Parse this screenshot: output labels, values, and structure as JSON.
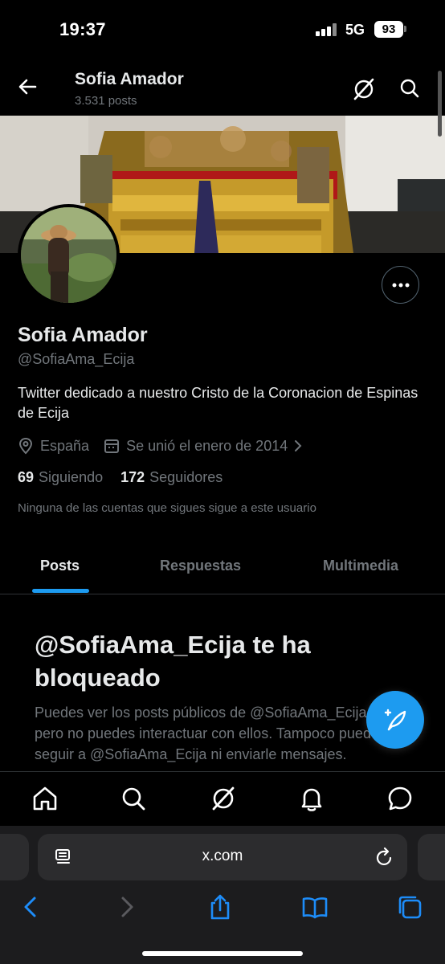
{
  "status_bar": {
    "time": "19:37",
    "network": "5G",
    "battery": "93"
  },
  "header": {
    "name": "Sofia Amador",
    "posts_count": "3.531 posts"
  },
  "profile": {
    "name": "Sofia Amador",
    "handle": "@SofiaAma_Ecija",
    "bio": "Twitter dedicado a nuestro Cristo de la Coronacion de Espinas de Ecija",
    "location": "España",
    "joined": "Se unió el enero de 2014",
    "following_count": "69",
    "following_label": "Siguiendo",
    "followers_count": "172",
    "followers_label": "Seguidores",
    "mutual_note": "Ninguna de las cuentas que sigues sigue a este usuario"
  },
  "tabs": [
    {
      "label": "Posts",
      "active": true
    },
    {
      "label": "Respuestas",
      "active": false
    },
    {
      "label": "Multimedia",
      "active": false
    }
  ],
  "blocked": {
    "title": "@SofiaAma_Ecija te ha bloqueado",
    "text": "Puedes ver los posts públicos de @SofiaAma_Ecija, pero no puedes interactuar con ellos. Tampoco puedes seguir a @SofiaAma_Ecija ni enviarle mensajes."
  },
  "browser": {
    "url": "x.com"
  },
  "colors": {
    "accent": "#1d9bf0",
    "muted": "#71767b",
    "text": "#e7e9ea",
    "background": "#000000"
  }
}
